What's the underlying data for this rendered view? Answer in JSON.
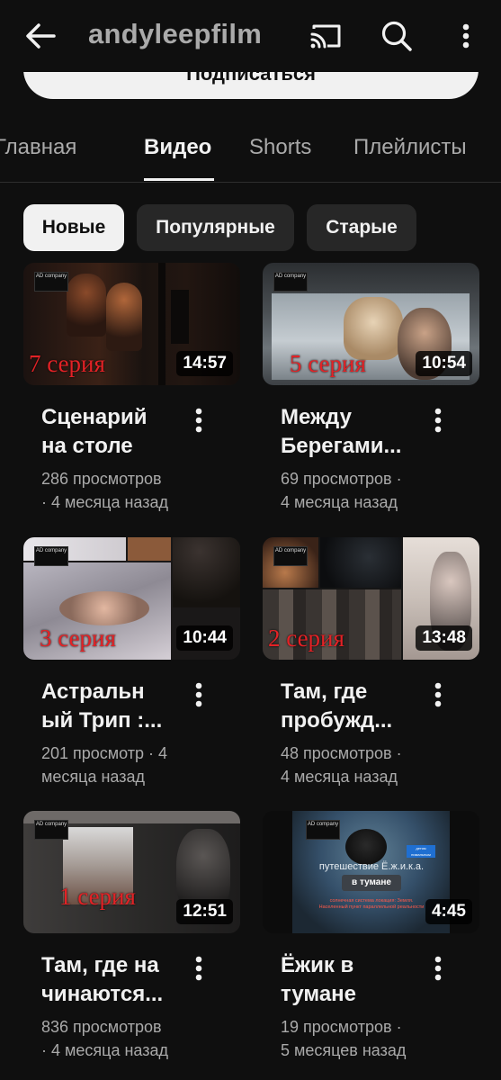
{
  "header": {
    "channel_name": "andyleepfilm",
    "back_icon": "arrow-left-icon",
    "cast_icon": "cast-icon",
    "search_icon": "search-icon",
    "more_icon": "more-vertical-icon"
  },
  "subscribe": {
    "label": "Подписаться"
  },
  "tabs": [
    {
      "label": "Главная",
      "active": false
    },
    {
      "label": "Видео",
      "active": true
    },
    {
      "label": "Shorts",
      "active": false
    },
    {
      "label": "Плейлисты",
      "active": false
    }
  ],
  "chips": [
    {
      "label": "Новые",
      "selected": true
    },
    {
      "label": "Популярные",
      "selected": false
    },
    {
      "label": "Старые",
      "selected": false
    }
  ],
  "videos": [
    {
      "title_line1": "Сценарий",
      "title_line2": "на столе",
      "meta_line1": "286 просмотров",
      "meta_line2": "· 4 месяца назад",
      "duration": "14:57",
      "episode": "7 серия",
      "badge": "AD company"
    },
    {
      "title_line1": "Между",
      "title_line2": "Берегами...",
      "meta_line1": "69 просмотров ·",
      "meta_line2": "4 месяца назад",
      "duration": "10:54",
      "episode": "5 серия",
      "badge": "AD company"
    },
    {
      "title_line1": "Астральн",
      "title_line2": "ый Трип :...",
      "meta_line1": "201 просмотр · 4",
      "meta_line2": "месяца назад",
      "duration": "10:44",
      "episode": "3 серия",
      "badge": "AD company"
    },
    {
      "title_line1": "Там, где",
      "title_line2": "пробужд...",
      "meta_line1": "48 просмотров ·",
      "meta_line2": "4 месяца назад",
      "duration": "13:48",
      "episode": "2 серия",
      "badge": "AD company"
    },
    {
      "title_line1": "Там, где на",
      "title_line2": "чинаются...",
      "meta_line1": "836 просмотров",
      "meta_line2": "· 4 месяца назад",
      "duration": "12:51",
      "episode": "1 серия",
      "badge": "AD company"
    },
    {
      "title_line1": "Ёжик в",
      "title_line2": "тумане",
      "meta_line1": "19 просмотров ·",
      "meta_line2": "5 месяцев назад",
      "duration": "4:45",
      "badge": "AD company",
      "poster_title": "путешествие Ё.ж.и.к.а.",
      "poster_subtitle": "в тумане",
      "poster_caption": "солнечная система локация: Земля. Населенный пункт параллельной реальности",
      "poster_tag": "детям нимальным"
    }
  ],
  "colors": {
    "background": "#0f0f0f",
    "chip_selected": "#f1f1f1",
    "chip_unselected": "#272727",
    "episode_red": "#e32226",
    "meta_gray": "#aaaaaa"
  }
}
